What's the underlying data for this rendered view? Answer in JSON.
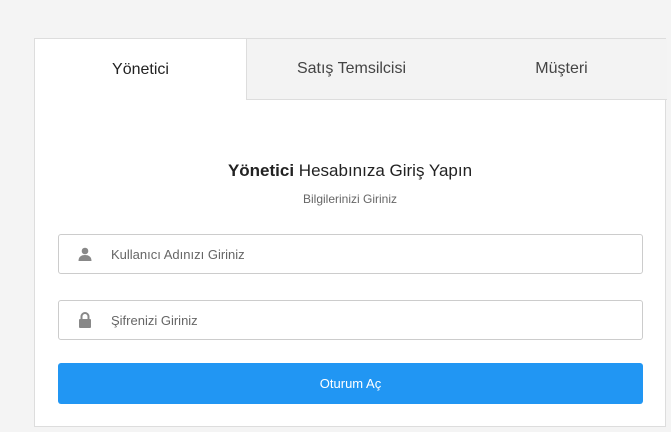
{
  "tabs": [
    {
      "label": "Yönetici",
      "active": true
    },
    {
      "label": "Satış Temsilcisi",
      "active": false
    },
    {
      "label": "Müşteri",
      "active": false
    }
  ],
  "form": {
    "heading_bold": "Yönetici",
    "heading_rest": " Hesabınıza Giriş Yapın",
    "subheading": "Bilgilerinizi Giriniz",
    "username": {
      "placeholder": "Kullanıcı Adınızı Giriniz",
      "value": "",
      "icon": "user-icon"
    },
    "password": {
      "placeholder": "Şifrenizi Giriniz",
      "value": "",
      "icon": "lock-icon"
    },
    "submit_label": "Oturum Aç"
  },
  "colors": {
    "accent": "#2196f3",
    "page_bg": "#f4f4f4",
    "inactive_tab_bg": "#f3f3f3"
  }
}
